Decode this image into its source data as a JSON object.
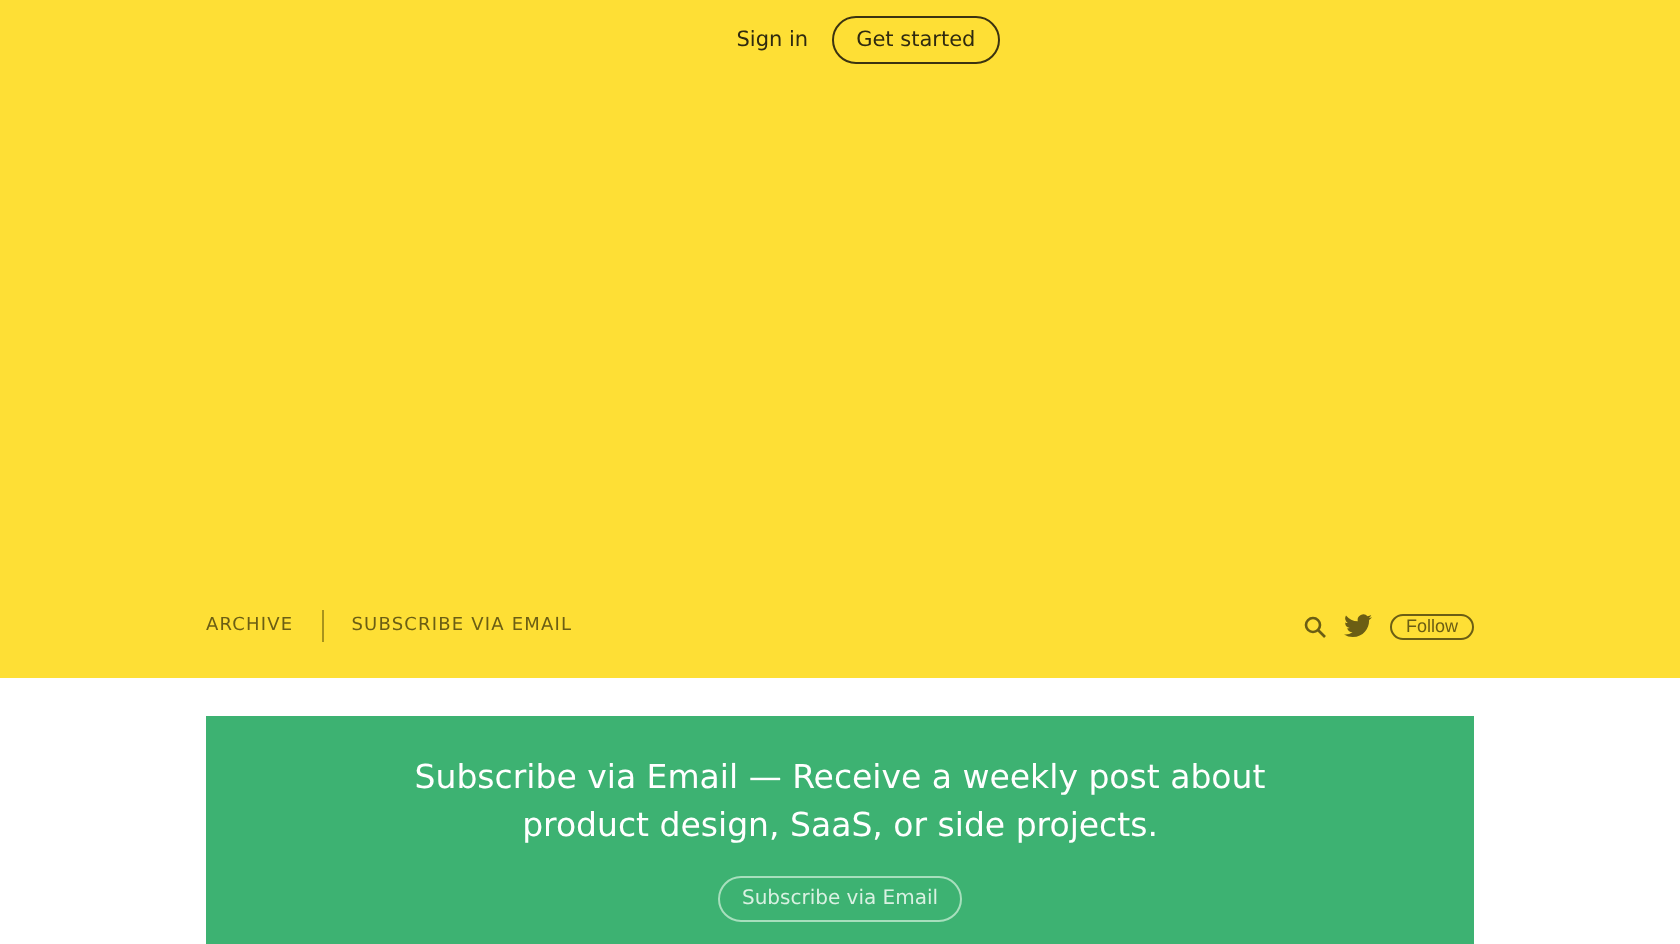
{
  "top_nav": {
    "sign_in": "Sign in",
    "get_started": "Get started"
  },
  "publication_nav": {
    "links": [
      "ARCHIVE",
      "SUBSCRIBE VIA EMAIL"
    ],
    "follow": "Follow"
  },
  "subscribe_banner": {
    "message": "Subscribe via Email — Receive a weekly post about product design, SaaS, or side projects.",
    "button": "Subscribe via Email"
  }
}
